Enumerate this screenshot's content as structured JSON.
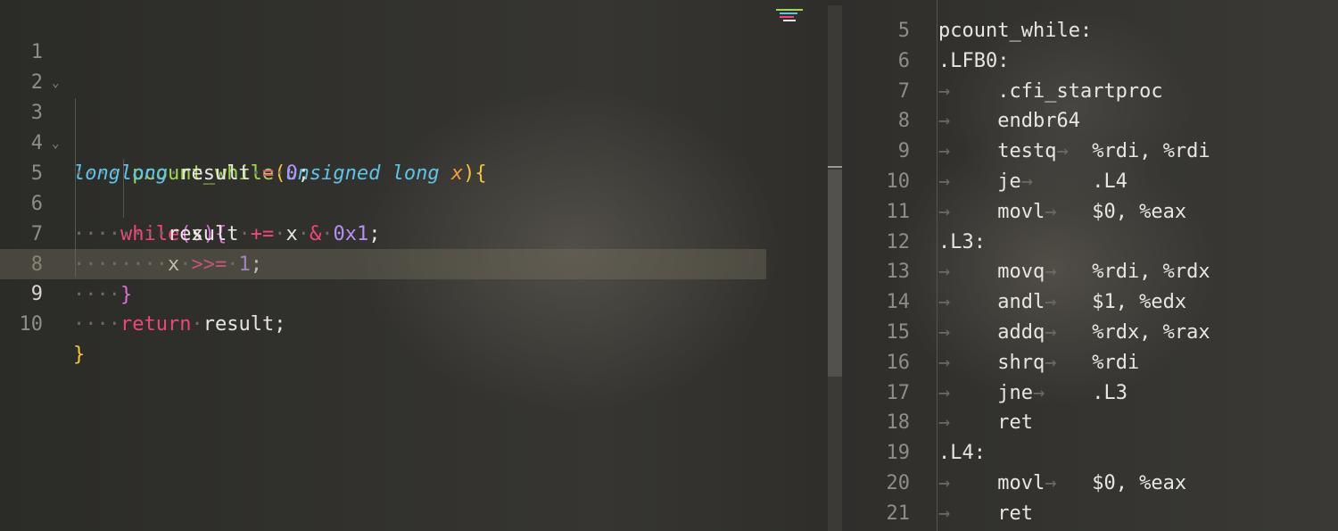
{
  "left_editor": {
    "line_numbers": [
      "1",
      "2",
      "3",
      "4",
      "5",
      "6",
      "7",
      "8",
      "9",
      "10"
    ],
    "l3": {
      "long": "long",
      "fname": "pcount_while",
      "lparen": "(",
      "unsigned": "unsigned",
      "long2": "long",
      "x": "x",
      "rparen": ")",
      "lbrace": "{"
    },
    "l4": {
      "long": "long",
      "result": "result",
      "eq": "=",
      "zero": "0",
      "semi": ";"
    },
    "l5": {
      "while": "while",
      "lparen": "(",
      "x": "x",
      "rparen": ")",
      "lbrace": "{"
    },
    "l6": {
      "result": "result",
      "pluseq": "+=",
      "x": "x",
      "amp": "&",
      "hex": "0x1",
      "semi": ";"
    },
    "l7": {
      "x": "x",
      "shift": ">>=",
      "one": "1",
      "semi": ";"
    },
    "l8": {
      "rbrace": "}"
    },
    "l9": {
      "ret": "return",
      "result": "result",
      "semi": ";"
    },
    "l10": {
      "rbrace": "}"
    }
  },
  "right_editor": {
    "line_numbers": [
      "5",
      "6",
      "7",
      "8",
      "9",
      "10",
      "11",
      "12",
      "13",
      "14",
      "15",
      "16",
      "17",
      "18",
      "19",
      "20",
      "21"
    ],
    "lines": [
      {
        "op": "pcount_while:",
        "args": ""
      },
      {
        "op": ".LFB0:",
        "args": ""
      },
      {
        "op": ".cfi_startproc",
        "args": ""
      },
      {
        "op": "endbr64",
        "args": ""
      },
      {
        "op": "testq",
        "args": "%rdi, %rdi"
      },
      {
        "op": "je",
        "args": ".L4"
      },
      {
        "op": "movl",
        "args": "$0, %eax"
      },
      {
        "op": ".L3:",
        "args": ""
      },
      {
        "op": "movq",
        "args": "%rdi, %rdx"
      },
      {
        "op": "andl",
        "args": "$1, %edx"
      },
      {
        "op": "addq",
        "args": "%rdx, %rax"
      },
      {
        "op": "shrq",
        "args": "%rdi"
      },
      {
        "op": "jne",
        "args": ".L3"
      },
      {
        "op": "ret",
        "args": ""
      },
      {
        "op": ".L4:",
        "args": ""
      },
      {
        "op": "movl",
        "args": "$0, %eax"
      },
      {
        "op": "ret",
        "args": ""
      }
    ]
  },
  "colors": {
    "keyword_type": "#5ec4e6",
    "function_name": "#9fd84d",
    "control": "#f0467c",
    "number": "#b98ef7",
    "bracket_outer": "#f7c43a",
    "bracket_inner": "#e06edb",
    "parameter": "#f59c38",
    "text": "#e8e6e0"
  }
}
